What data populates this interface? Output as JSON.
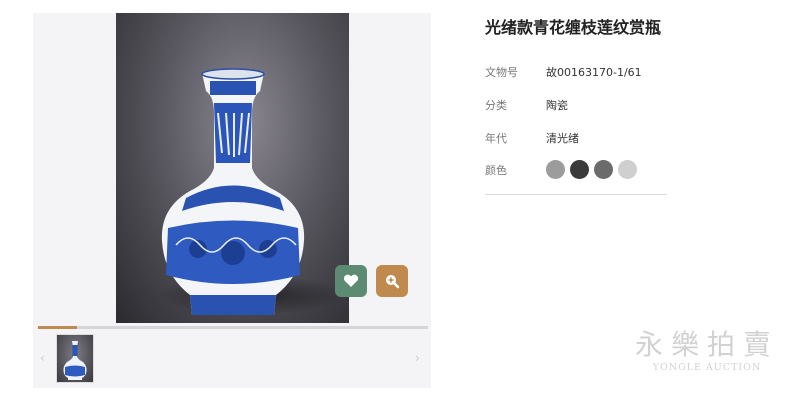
{
  "product": {
    "title": "光绪款青花缠枝莲纹赏瓶",
    "fields": [
      {
        "label": "文物号",
        "value": "故00163170-1/61"
      },
      {
        "label": "分类",
        "value": "陶瓷"
      },
      {
        "label": "年代",
        "value": "清光绪"
      }
    ],
    "color_label": "颜色",
    "colors": [
      "#9c9c9c",
      "#3a3a3a",
      "#6b6b6b",
      "#cfcfcf"
    ]
  },
  "gallery": {
    "image_icon": "blue-and-white-vase",
    "favorite_icon": "heart-icon",
    "zoom_icon": "zoom-plus-icon",
    "progress_fraction": 0.1,
    "prev_symbol": "‹",
    "next_symbol": "›"
  },
  "watermark": {
    "chinese": "永樂拍賣",
    "english": "YONGLE AUCTION"
  }
}
